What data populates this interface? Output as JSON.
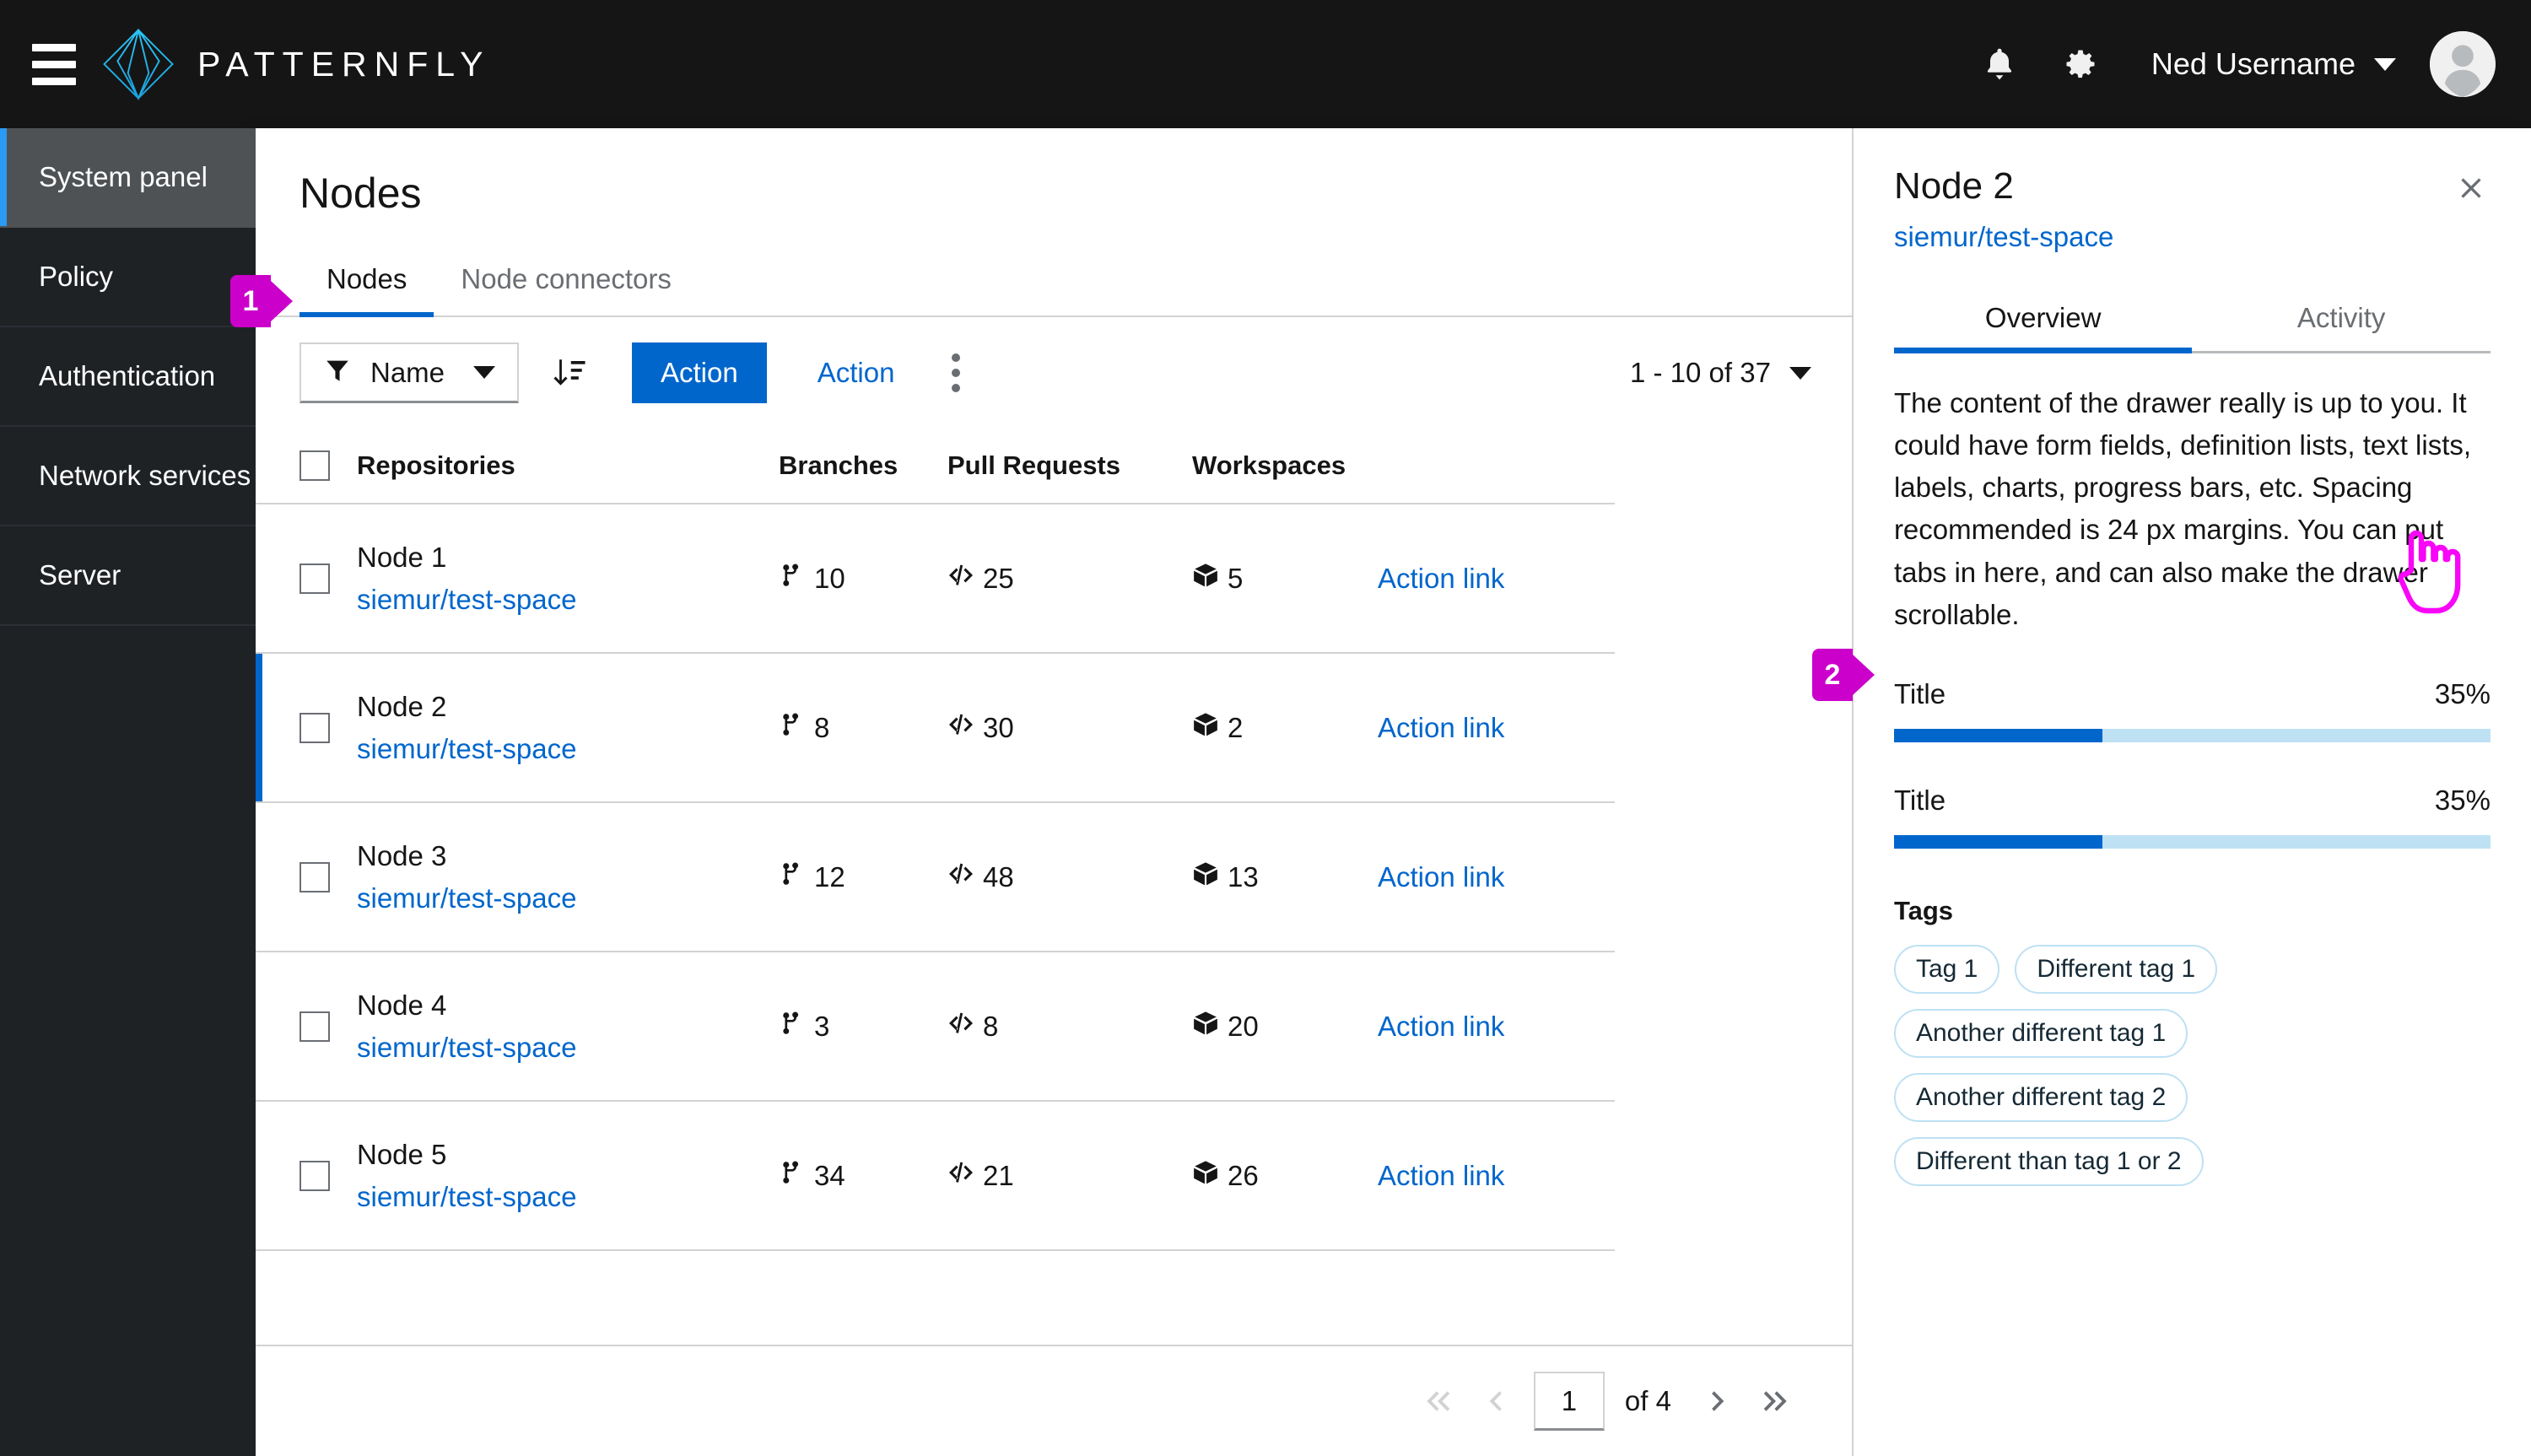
{
  "masthead": {
    "hamburger_name": "global-nav-toggle",
    "brand_text": "PATTERNFLY",
    "notifications_label": "Notifications",
    "settings_label": "Settings",
    "user_name": "Ned Username"
  },
  "sidebar": {
    "items": [
      {
        "label": "System panel",
        "active": true
      },
      {
        "label": "Policy",
        "active": false
      },
      {
        "label": "Authentication",
        "active": false
      },
      {
        "label": "Network services",
        "active": false
      },
      {
        "label": "Server",
        "active": false
      }
    ]
  },
  "page": {
    "title": "Nodes",
    "tabs": [
      {
        "label": "Nodes",
        "active": true
      },
      {
        "label": "Node connectors",
        "active": false
      }
    ]
  },
  "toolbar": {
    "filter_label": "Name",
    "filter_icon": "filter-icon",
    "sort_icon": "sort-amount-down-icon",
    "primary_action_label": "Action",
    "secondary_action_label": "Action",
    "kebab_icon": "kebab-vertical-icon",
    "pagination_summary": "1 - 10 of 37"
  },
  "table": {
    "columns": [
      "Repositories",
      "Branches",
      "Pull Requests",
      "Workspaces",
      ""
    ],
    "rows": [
      {
        "name": "Node 1",
        "link": "siemur/test-space",
        "branches": "10",
        "pull_requests": "25",
        "workspaces": "5",
        "action": "Action link",
        "selected": false
      },
      {
        "name": "Node 2",
        "link": "siemur/test-space",
        "branches": "8",
        "pull_requests": "30",
        "workspaces": "2",
        "action": "Action link",
        "selected": true
      },
      {
        "name": "Node 3",
        "link": "siemur/test-space",
        "branches": "12",
        "pull_requests": "48",
        "workspaces": "13",
        "action": "Action link",
        "selected": false
      },
      {
        "name": "Node 4",
        "link": "siemur/test-space",
        "branches": "3",
        "pull_requests": "8",
        "workspaces": "20",
        "action": "Action link",
        "selected": false
      },
      {
        "name": "Node 5",
        "link": "siemur/test-space",
        "branches": "34",
        "pull_requests": "21",
        "workspaces": "26",
        "action": "Action link",
        "selected": false
      }
    ]
  },
  "pagination": {
    "first_label": "First page",
    "prev_label": "Previous page",
    "page_value": "1",
    "of_label": "of 4",
    "next_label": "Next page",
    "last_label": "Last page"
  },
  "drawer": {
    "title": "Node 2",
    "subtitle": "siemur/test-space",
    "close_label": "Close drawer",
    "tabs": [
      {
        "label": "Overview",
        "active": true
      },
      {
        "label": "Activity",
        "active": false
      }
    ],
    "body_text": "The content of the drawer really is up to you. It could have form fields, definition lists, text lists, labels, charts, progress bars, etc. Spacing recommended is 24 px margins. You can put tabs in here, and can also make the drawer scrollable.",
    "progress": [
      {
        "label": "Title",
        "value": "35%",
        "percent": 35
      },
      {
        "label": "Title",
        "value": "35%",
        "percent": 35
      }
    ],
    "tags_label": "Tags",
    "tags": [
      "Tag 1",
      "Different tag 1",
      "Another different tag 1",
      "Another different tag 2",
      "Different than tag 1 or 2"
    ]
  },
  "callouts": [
    {
      "number": "1",
      "target": "nodes-tab"
    },
    {
      "number": "2",
      "target": "drawer-overview-tab"
    }
  ],
  "colors": {
    "accent_blue": "#0066cc",
    "active_nav_blue": "#2b9af3",
    "callout_magenta": "#cb00cb",
    "cursor_pink": "#f0f",
    "masthead_black": "#151515",
    "sidebar_dark": "#1f2225",
    "progress_track": "#bee1f4"
  }
}
